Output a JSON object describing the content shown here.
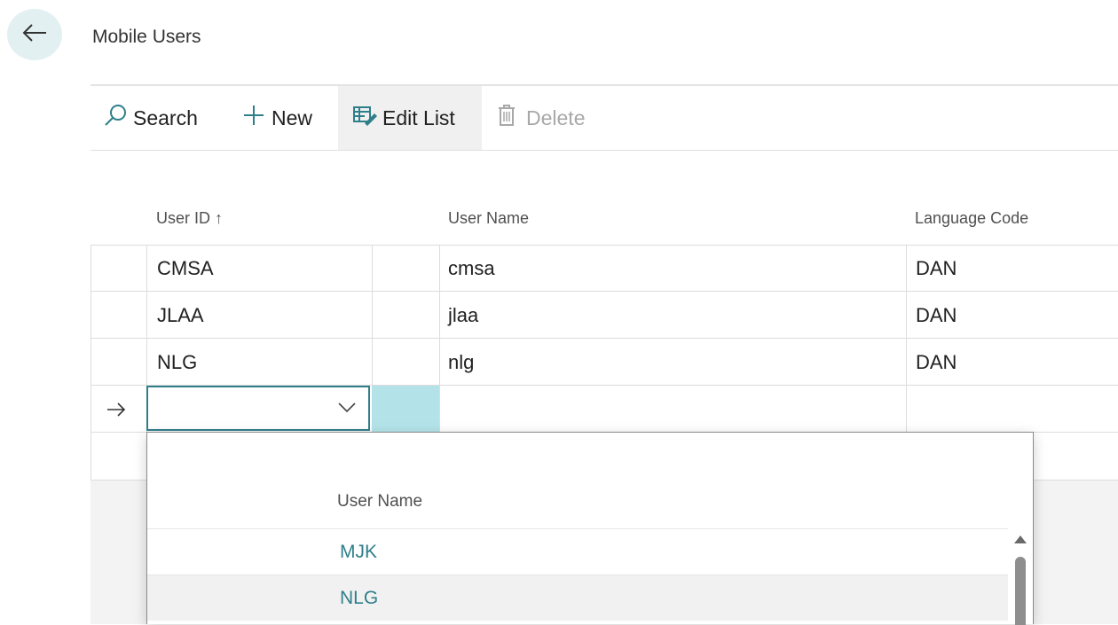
{
  "header": {
    "title": "Mobile Users"
  },
  "toolbar": {
    "search_label": "Search",
    "new_label": "New",
    "edit_list_label": "Edit List",
    "delete_label": "Delete"
  },
  "table": {
    "columns": [
      "User ID ↑",
      "User Name",
      "Language Code"
    ],
    "rows": [
      {
        "user_id": "CMSA",
        "user_name": "cmsa",
        "language_code": "DAN"
      },
      {
        "user_id": "JLAA",
        "user_name": "jlaa",
        "language_code": "DAN"
      },
      {
        "user_id": "NLG",
        "user_name": "nlg",
        "language_code": "DAN"
      }
    ],
    "new_row": {
      "user_id": "",
      "user_name": "",
      "language_code": ""
    }
  },
  "lookup": {
    "column_header": "User Name",
    "items": [
      "MJK",
      "NLG"
    ]
  },
  "colors": {
    "accent": "#2f7f8a",
    "selected_cell": "#b3e3e9",
    "back_button_bg": "#e3f0f2"
  }
}
